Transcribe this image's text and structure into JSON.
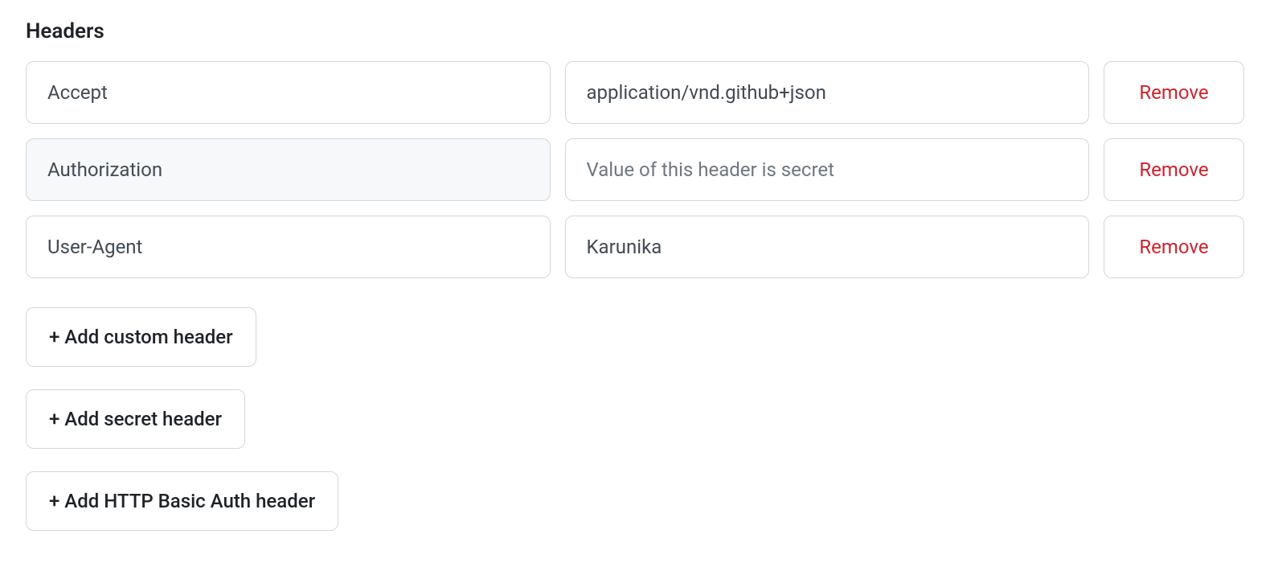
{
  "section": {
    "title": "Headers"
  },
  "headers": [
    {
      "name": "Accept",
      "value": "application/vnd.github+json",
      "secret": false,
      "placeholder": ""
    },
    {
      "name": "Authorization",
      "value": "",
      "secret": true,
      "placeholder": "Value of this header is secret"
    },
    {
      "name": "User-Agent",
      "value": "Karunika",
      "secret": false,
      "placeholder": ""
    }
  ],
  "buttons": {
    "remove": "Remove",
    "add_custom": "+ Add custom header",
    "add_secret": "+ Add secret header",
    "add_basic_auth": "+ Add HTTP Basic Auth header"
  }
}
